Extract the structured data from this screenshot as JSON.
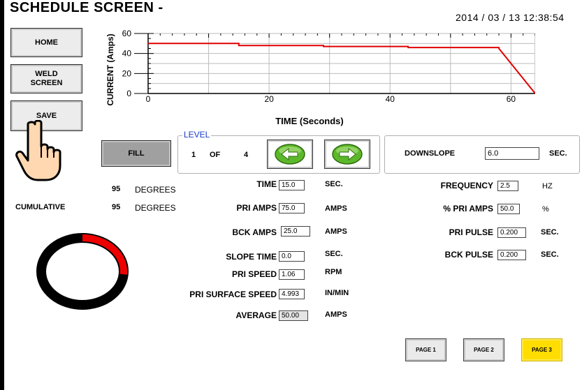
{
  "header": {
    "title": "SCHEDULE SCREEN -",
    "datetime": "2014 / 03 / 13   12:38:54"
  },
  "nav": {
    "home": "HOME",
    "weld_screen_line1": "WELD",
    "weld_screen_line2": "SCREEN",
    "save": "SAVE"
  },
  "chart_data": {
    "type": "line",
    "xlabel": "TIME (Seconds)",
    "ylabel": "CURRENT (Amps)",
    "xlim": [
      0,
      64
    ],
    "ylim": [
      0,
      60
    ],
    "x_ticks": [
      0,
      20,
      40,
      60
    ],
    "y_ticks": [
      0,
      20,
      40,
      60
    ],
    "grid": true,
    "line_color": "#e00000",
    "series": [
      {
        "x": [
          0,
          15,
          15,
          29,
          29,
          43,
          43,
          58,
          58,
          64
        ],
        "y": [
          50,
          50,
          48,
          48,
          47,
          47,
          46,
          46,
          45,
          0
        ]
      }
    ]
  },
  "level": {
    "title": "LEVEL",
    "fill_label": "FILL",
    "current": "1",
    "of_label": "OF",
    "total": "4",
    "prev_icon": "left-arrow-icon",
    "next_icon": "right-arrow-icon"
  },
  "downslope": {
    "label": "DOWNSLOPE",
    "value": "6.0",
    "unit": "SEC."
  },
  "degrees": {
    "value": "95",
    "unit": "DEGREES",
    "cumulative_label": "CUMULATIVE",
    "cumulative_value": "95",
    "cumulative_unit": "DEGREES",
    "progress_fraction": 0.264,
    "progress_color": "#ee0000"
  },
  "params": {
    "time": {
      "label": "TIME",
      "value": "15.0",
      "unit": "SEC."
    },
    "pri_amps": {
      "label": "PRI AMPS",
      "value": "75.0",
      "unit": "AMPS"
    },
    "bck_amps": {
      "label": "BCK AMPS",
      "value": "25.0",
      "unit": "AMPS"
    },
    "slope_time": {
      "label": "SLOPE TIME",
      "value": "0.0",
      "unit": "SEC."
    },
    "pri_speed": {
      "label": "PRI SPEED",
      "value": "1.06",
      "unit": "RPM"
    },
    "pri_surface_speed": {
      "label": "PRI SURFACE SPEED",
      "value": "4.993",
      "unit": "IN/MIN"
    },
    "average": {
      "label": "AVERAGE",
      "value": "50.00",
      "unit": "AMPS"
    }
  },
  "pulse": {
    "frequency": {
      "label": "FREQUENCY",
      "value": "2.5",
      "unit": "HZ"
    },
    "pct_pri_amps": {
      "label": "% PRI AMPS",
      "value": "50.0",
      "unit": "%"
    },
    "pri_pulse": {
      "label": "PRI PULSE",
      "value": "0.200",
      "unit": "SEC."
    },
    "bck_pulse": {
      "label": "BCK PULSE",
      "value": "0.200",
      "unit": "SEC."
    }
  },
  "pages": {
    "page1": "PAGE 1",
    "page2": "PAGE 2",
    "page3": "PAGE 3",
    "active": "page3",
    "active_color": "#ffdd00"
  },
  "pointer_icon": "hand-pointer-icon"
}
